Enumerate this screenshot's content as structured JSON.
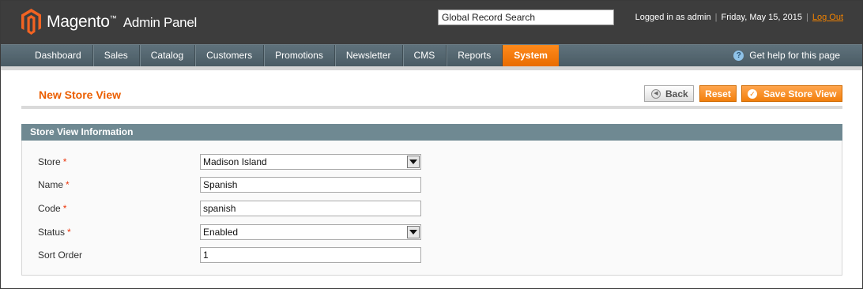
{
  "header": {
    "logo_main": "Magento",
    "logo_tm": "™",
    "logo_sub": "Admin Panel",
    "search_value": "Global Record Search",
    "logged_in": "Logged in as admin",
    "date": "Friday, May 15, 2015",
    "logout": "Log Out"
  },
  "nav": {
    "items": [
      "Dashboard",
      "Sales",
      "Catalog",
      "Customers",
      "Promotions",
      "Newsletter",
      "CMS",
      "Reports",
      "System"
    ],
    "active": "System",
    "help": "Get help for this page",
    "help_icon": "question-icon"
  },
  "page": {
    "title": "New Store View",
    "buttons": {
      "back": "Back",
      "reset": "Reset",
      "save": "Save Store View"
    }
  },
  "fieldset": {
    "title": "Store View Information",
    "store_label": "Store",
    "store_value": "Madison Island",
    "name_label": "Name",
    "name_value": "Spanish",
    "code_label": "Code",
    "code_value": "spanish",
    "status_label": "Status",
    "status_value": "Enabled",
    "sort_label": "Sort Order",
    "sort_value": "1",
    "required_mark": "*"
  },
  "colors": {
    "header_bg": "#3d3d3d",
    "nav_bg": "#5a6d77",
    "accent_orange": "#f27f0d",
    "title_orange": "#eb5e00",
    "fieldset_head": "#6f8992"
  }
}
